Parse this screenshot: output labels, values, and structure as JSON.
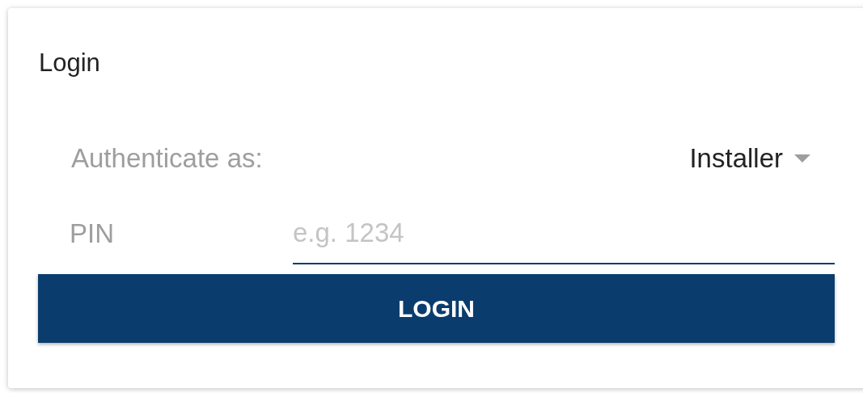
{
  "card": {
    "title": "Login"
  },
  "role": {
    "label": "Authenticate as:",
    "value": "Installer"
  },
  "pin": {
    "label": "PIN",
    "placeholder": "e.g. 1234",
    "focused": true
  },
  "button": {
    "label": "LOGIN"
  }
}
